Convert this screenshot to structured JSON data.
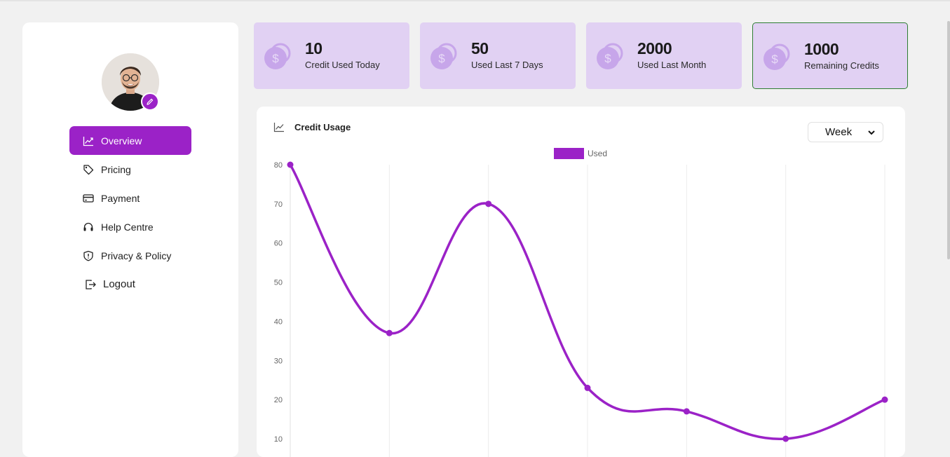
{
  "sidebar": {
    "nav": [
      {
        "label": "Overview",
        "icon": "trend-chart-icon",
        "active": true
      },
      {
        "label": "Pricing",
        "icon": "tag-icon"
      },
      {
        "label": "Payment",
        "icon": "credit-card-icon"
      },
      {
        "label": "Help Centre",
        "icon": "headset-icon"
      },
      {
        "label": "Privacy & Policy",
        "icon": "shield-icon"
      },
      {
        "label": "Logout",
        "icon": "logout-icon"
      }
    ]
  },
  "stats": [
    {
      "value": "10",
      "label": "Credit Used Today"
    },
    {
      "value": "50",
      "label": "Used Last 7 Days"
    },
    {
      "value": "2000",
      "label": "Used Last Month"
    },
    {
      "value": "1000",
      "label": "Remaining Credits"
    }
  ],
  "panel": {
    "title": "Credit Usage",
    "period_select": "Week"
  },
  "colors": {
    "accent": "#9b22c7",
    "card_bg": "#e1d1f3",
    "highlight_border": "#2e7d32"
  },
  "chart_data": {
    "type": "line",
    "legend": [
      "Used"
    ],
    "series": [
      {
        "name": "Used",
        "values": [
          80,
          37,
          70,
          23,
          17,
          10,
          20
        ]
      }
    ],
    "y_ticks": [
      80,
      70,
      60,
      50,
      40,
      30,
      20,
      10
    ],
    "ylim": [
      10,
      80
    ],
    "grid": true,
    "legend_position": "top-center"
  }
}
